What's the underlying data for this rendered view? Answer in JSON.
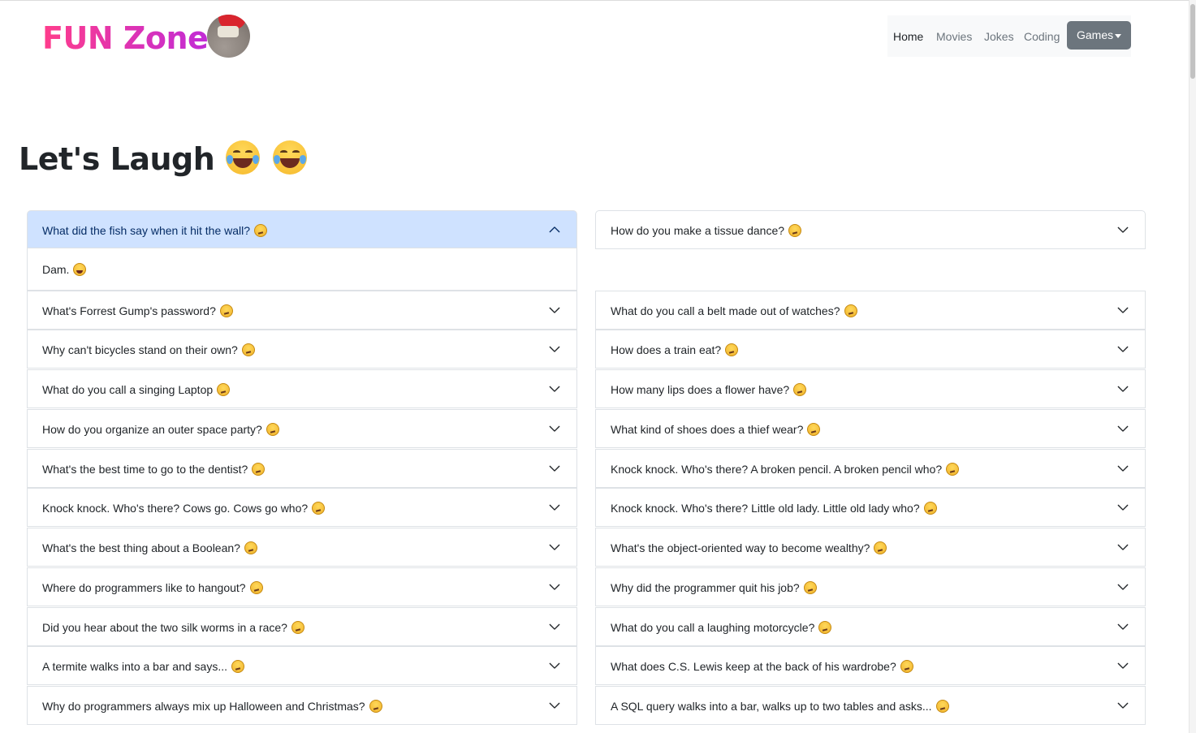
{
  "header": {
    "brand": "FUN Zone",
    "nav": {
      "home": "Home",
      "movies": "Movies",
      "jokes": "Jokes",
      "coding": "Coding",
      "games": "Games"
    }
  },
  "page": {
    "title": "Let's Laugh"
  },
  "accordion": {
    "left": [
      {
        "q": "What did the fish say when it hit the wall?",
        "open": true,
        "answer": "Dam."
      },
      {
        "q": "What's Forrest Gump's password?"
      },
      {
        "q": "Why can't bicycles stand on their own?"
      },
      {
        "q": "What do you call a singing Laptop"
      },
      {
        "q": "How do you organize an outer space party?"
      },
      {
        "q": "What's the best time to go to the dentist?"
      },
      {
        "q": "Knock knock. Who's there? Cows go. Cows go who?"
      },
      {
        "q": "What's the best thing about a Boolean?"
      },
      {
        "q": "Where do programmers like to hangout?"
      },
      {
        "q": "Did you hear about the two silk worms in a race?"
      },
      {
        "q": "A termite walks into a bar and says..."
      },
      {
        "q": "Why do programmers always mix up Halloween and Christmas?"
      }
    ],
    "right": [
      {
        "q": "How do you make a tissue dance?"
      },
      {
        "q": "What do you call a belt made out of watches?"
      },
      {
        "q": "How does a train eat?"
      },
      {
        "q": "How many lips does a flower have?"
      },
      {
        "q": "What kind of shoes does a thief wear?"
      },
      {
        "q": "Knock knock. Who's there? A broken pencil. A broken pencil who?"
      },
      {
        "q": "Knock knock. Who's there? Little old lady. Little old lady who?"
      },
      {
        "q": "What's the object-oriented way to become wealthy?"
      },
      {
        "q": "Why did the programmer quit his job?"
      },
      {
        "q": "What do you call a laughing motorcycle?"
      },
      {
        "q": "What does C.S. Lewis keep at the back of his wardrobe?"
      },
      {
        "q": "A SQL query walks into a bar, walks up to two tables and asks..."
      }
    ]
  },
  "icons": {
    "question_emoji": "thinking-face-icon",
    "answer_emoji": "grinning-squinting-face-icon",
    "title_emoji": "face-with-tears-of-joy-icon",
    "chevron": "chevron-down-icon"
  },
  "colors": {
    "brand_start": "#ff3d8b",
    "brand_end": "#c12bd6",
    "open_item_bg": "#cfe2ff",
    "games_button_bg": "#6c757d",
    "nav_bg": "#f8f9fa"
  }
}
